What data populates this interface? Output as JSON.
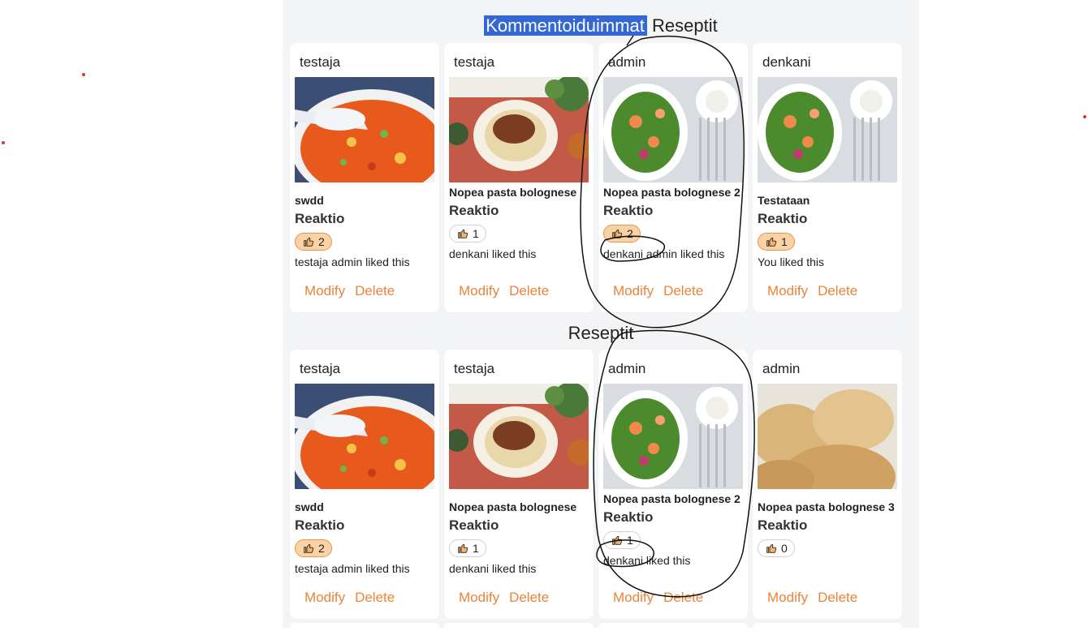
{
  "sections": {
    "top_title_highlight": "Kommentoiduimmat",
    "top_title_rest": "Reseptit",
    "bottom_title": "Reseptit"
  },
  "reaction_heading": "Reaktio",
  "actions": {
    "modify": "Modify",
    "delete": "Delete"
  },
  "top_cards": [
    {
      "author": "testaja",
      "title": "swdd",
      "image": "soup",
      "likes": "2",
      "active": true,
      "liked_by": "testaja admin liked this"
    },
    {
      "author": "testaja",
      "title": "Nopea pasta bolognese",
      "image": "pasta",
      "likes": "1",
      "active": false,
      "liked_by": "denkani liked this"
    },
    {
      "author": "admin",
      "title": "Nopea pasta bolognese 2",
      "image": "salad",
      "likes": "2",
      "active": true,
      "liked_by": "denkani admin liked this"
    },
    {
      "author": "denkani",
      "title": "Testataan",
      "image": "salad",
      "likes": "1",
      "active": true,
      "liked_by": "You liked this"
    }
  ],
  "bottom_cards": [
    {
      "author": "testaja",
      "title": "swdd",
      "image": "soup",
      "likes": "2",
      "active": true,
      "liked_by": "testaja admin liked this"
    },
    {
      "author": "testaja",
      "title": "Nopea pasta bolognese",
      "image": "pasta",
      "likes": "1",
      "active": false,
      "liked_by": "denkani liked this"
    },
    {
      "author": "admin",
      "title": "Nopea pasta bolognese 2",
      "image": "salad",
      "likes": "1",
      "active": false,
      "liked_by": "denkani liked this"
    },
    {
      "author": "admin",
      "title": "Nopea pasta bolognese 3",
      "image": "buns",
      "likes": "0",
      "active": false,
      "liked_by": ""
    }
  ]
}
